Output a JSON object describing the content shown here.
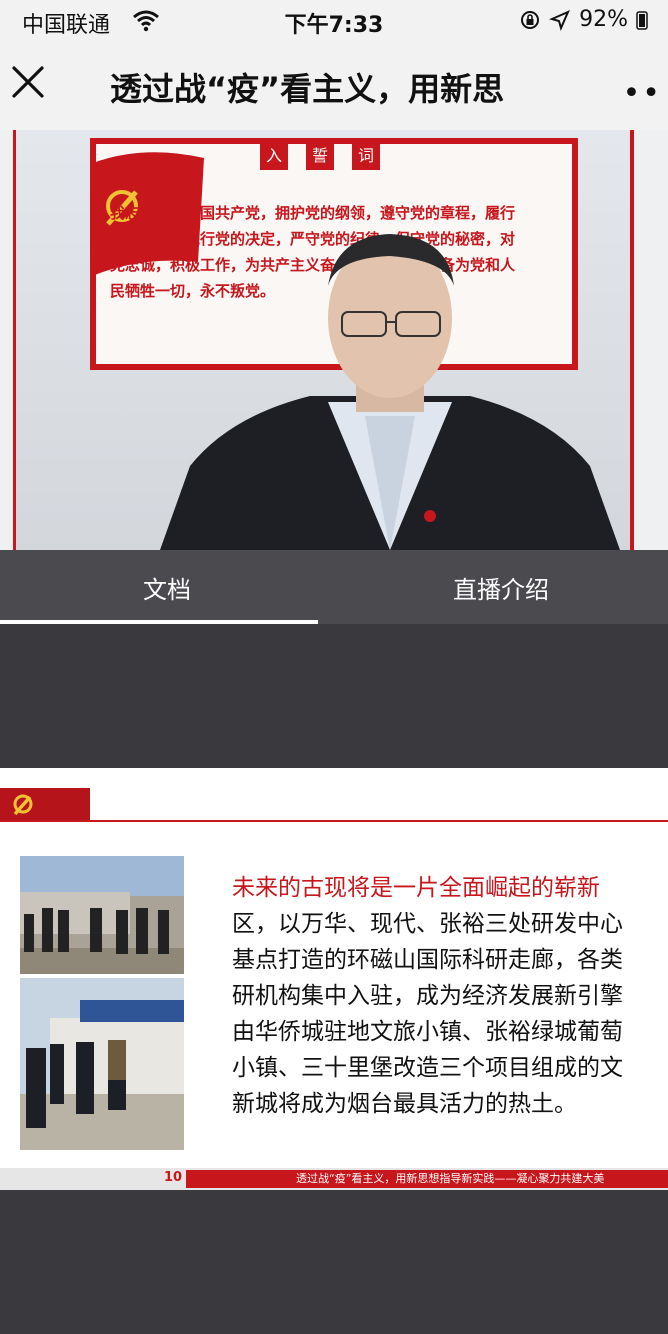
{
  "status_bar": {
    "carrier": "中国联通",
    "time": "下午7:33",
    "battery": "92%"
  },
  "nav": {
    "title": "透过战“疫”看主义，用新思"
  },
  "video": {
    "board_heading": [
      "入",
      "誓",
      "词"
    ],
    "board_text": "我志愿加入中国共产党，拥护党的纲领，遵守党的章程，履行党员义务，执行党的决定，严守党的纪律，保守党的秘密，对党忠诚，积极工作，为共产主义奋斗终身，随时准备为党和人民牺牲一切，永不叛党。"
  },
  "tabs": [
    {
      "label": "文档",
      "active": true
    },
    {
      "label": "直播介绍",
      "active": false
    }
  ],
  "slide": {
    "text_lines": [
      "未来的古现将是一片全面崛起的崭新",
      "区，以万华、现代、张裕三处研发中心",
      "基点打造的环磁山国际科研走廊，各类",
      "研机构集中入驻，成为经济发展新引擎",
      "由华侨城驻地文旅小镇、张裕绿城葡萄",
      "小镇、三十里堡改造三个项目组成的文",
      "新城将成为烟台最具活力的热土。"
    ],
    "page_number": "10",
    "footer_text": "透过战“疫”看主义，用新思想指导新实践——凝心聚力共建大美"
  },
  "colors": {
    "party_red": "#c8161d",
    "tab_bar": "#4a4a4f",
    "page_bg": "#3a3a3e"
  }
}
